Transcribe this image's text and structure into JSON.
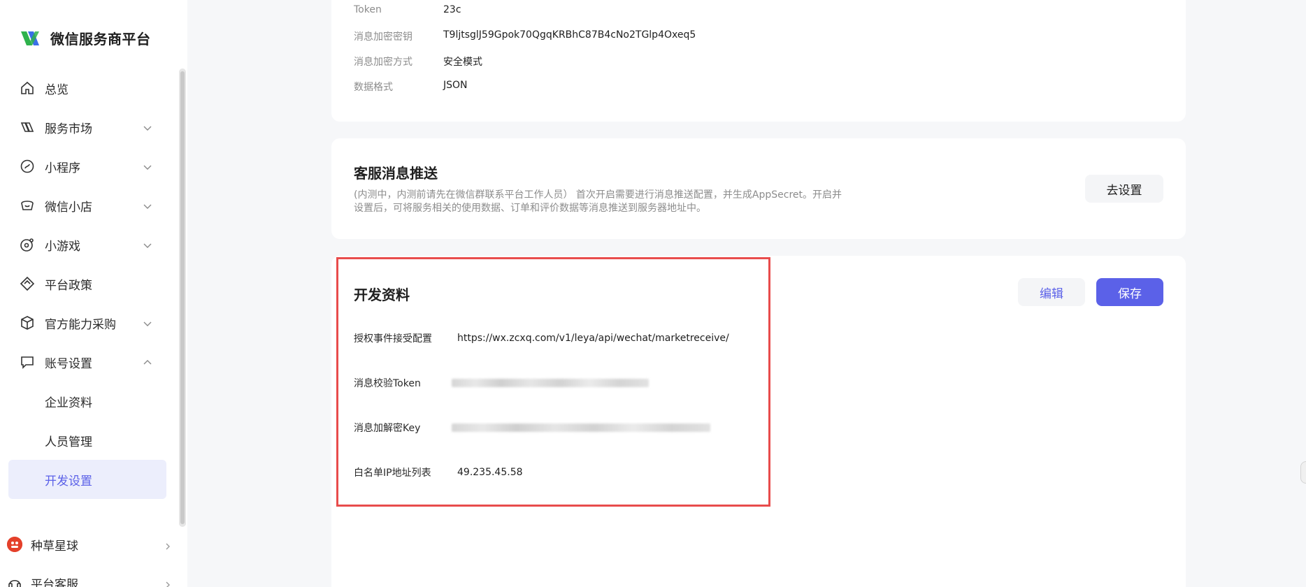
{
  "brand": {
    "title": "微信服务商平台"
  },
  "nav": {
    "items": [
      {
        "label": "总览",
        "icon": "home-icon"
      },
      {
        "label": "服务市场",
        "icon": "market-icon"
      },
      {
        "label": "小程序",
        "icon": "mini-program-icon"
      },
      {
        "label": "微信小店",
        "icon": "shop-icon"
      },
      {
        "label": "小游戏",
        "icon": "game-icon"
      },
      {
        "label": "平台政策",
        "icon": "policy-icon"
      },
      {
        "label": "官方能力采购",
        "icon": "box-icon"
      },
      {
        "label": "账号设置",
        "icon": "account-icon"
      }
    ],
    "sub_items": [
      {
        "label": "企业资料"
      },
      {
        "label": "人员管理"
      },
      {
        "label": "开发设置"
      }
    ],
    "bottom": [
      {
        "label": "种草星球",
        "badge": "种草星球"
      },
      {
        "label": "平台客服"
      }
    ]
  },
  "card1": {
    "rows": [
      {
        "k": "Token",
        "v": "23c"
      },
      {
        "k": "消息加密密钥",
        "v": "T9ljtsglJ59Gpok70QgqKRBhC87B4cNo2TGlp4Oxeq5"
      },
      {
        "k": "消息加密方式",
        "v": "安全模式"
      },
      {
        "k": "数据格式",
        "v": "JSON"
      }
    ]
  },
  "card2": {
    "title": "客服消息推送",
    "desc": "(内测中，内测前请先在微信群联系平台工作人员）  首次开启需要进行消息推送配置，并生成AppSecret。开启并设置后，可将服务相关的使用数据、订单和评价数据等消息推送到服务器地址中。",
    "button": "去设置"
  },
  "card3": {
    "title": "开发资料",
    "edit_button": "编辑",
    "save_button": "保存",
    "fields": [
      {
        "k": "授权事件接受配置",
        "v": "https://wx.zcxq.com/v1/leya/api/wechat/marketreceive/"
      },
      {
        "k": "消息校验Token",
        "v": ""
      },
      {
        "k": "消息加解密Key",
        "v": ""
      },
      {
        "k": "白名单IP地址列表",
        "v": "49.235.45.58"
      }
    ]
  },
  "colors": {
    "accent": "#5b61e8",
    "highlight": "#e84c4c",
    "active_bg": "#eceefc"
  }
}
